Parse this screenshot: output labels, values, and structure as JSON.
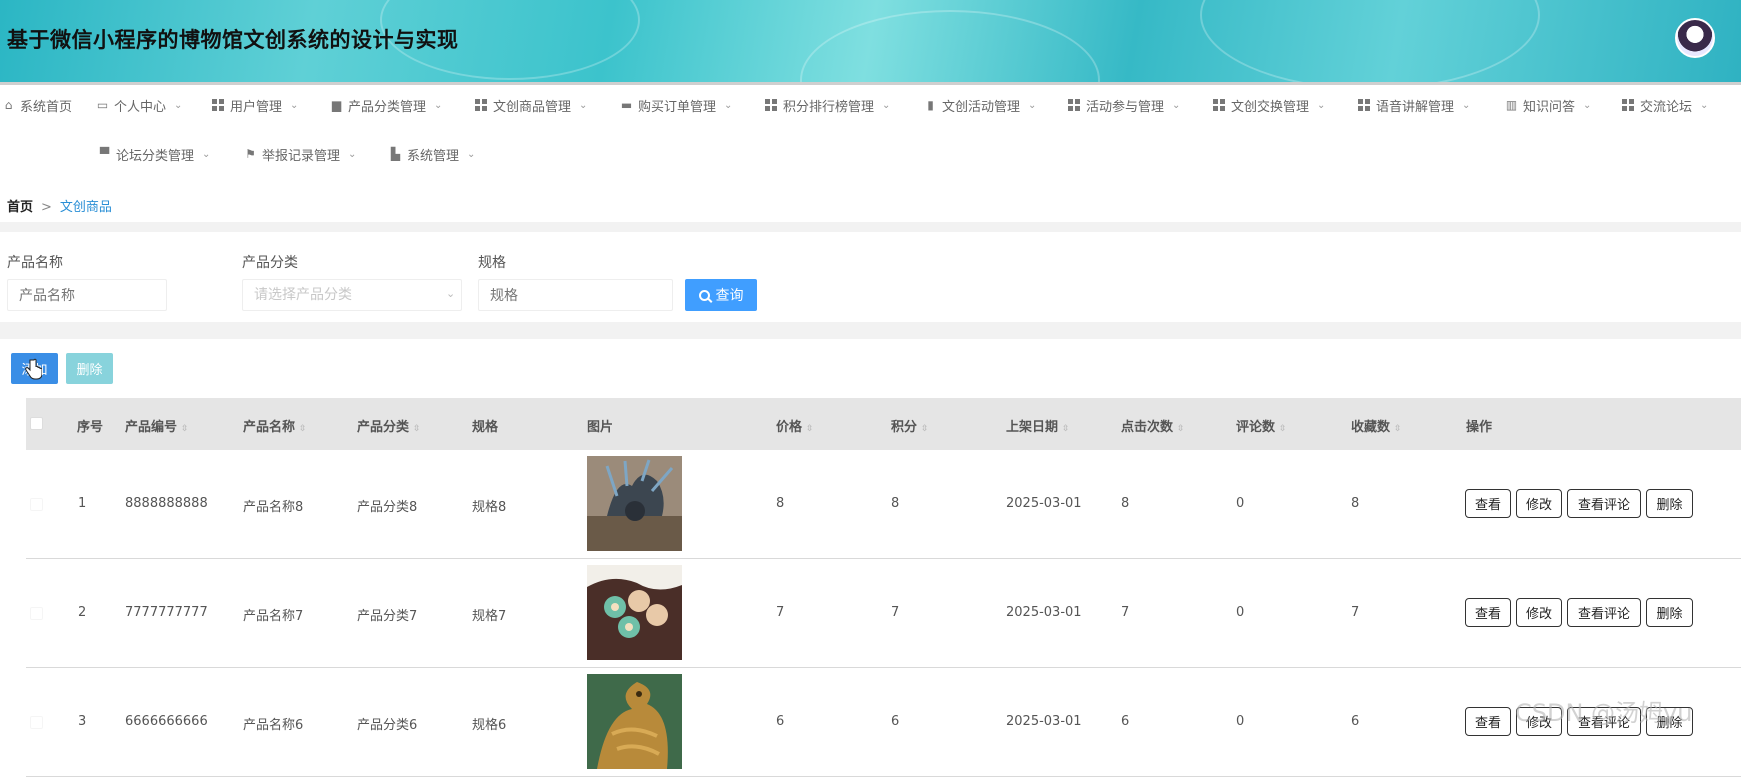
{
  "app": {
    "title": "基于微信小程序的博物馆文创系统的设计与实现"
  },
  "nav": {
    "row1": [
      {
        "label": "系统首页",
        "icon": "home-icon",
        "has_menu": false
      },
      {
        "label": "个人中心",
        "icon": "card-icon",
        "has_menu": true
      },
      {
        "label": "用户管理",
        "icon": "grid-icon",
        "has_menu": true
      },
      {
        "label": "产品分类管理",
        "icon": "chat-icon",
        "has_menu": true
      },
      {
        "label": "文创商品管理",
        "icon": "grid-icon",
        "has_menu": true
      },
      {
        "label": "购买订单管理",
        "icon": "briefcase-icon",
        "has_menu": true
      },
      {
        "label": "积分排行榜管理",
        "icon": "grid-icon",
        "has_menu": true
      },
      {
        "label": "文创活动管理",
        "icon": "clipboard-icon",
        "has_menu": true
      },
      {
        "label": "活动参与管理",
        "icon": "grid-icon",
        "has_menu": true
      },
      {
        "label": "文创交换管理",
        "icon": "apps-icon",
        "has_menu": true
      },
      {
        "label": "语音讲解管理",
        "icon": "grid-icon",
        "has_menu": true
      },
      {
        "label": "知识问答",
        "icon": "chart-icon",
        "has_menu": true
      },
      {
        "label": "交流论坛",
        "icon": "grid-icon",
        "has_menu": true
      }
    ],
    "row2": [
      {
        "label": "论坛分类管理",
        "icon": "monitor-icon",
        "has_menu": true
      },
      {
        "label": "举报记录管理",
        "icon": "flag-icon",
        "has_menu": true
      },
      {
        "label": "系统管理",
        "icon": "settings-icon",
        "has_menu": true
      }
    ]
  },
  "breadcrumb": {
    "home": "首页",
    "separator": ">",
    "current": "文创商品"
  },
  "search": {
    "name_label": "产品名称",
    "name_placeholder": "产品名称",
    "category_label": "产品分类",
    "category_placeholder": "请选择产品分类",
    "spec_label": "规格",
    "spec_placeholder": "规格",
    "query_button": "查询"
  },
  "actions": {
    "add": "添加",
    "delete": "删除"
  },
  "table": {
    "columns": {
      "index": "序号",
      "code": "产品编号",
      "name": "产品名称",
      "category": "产品分类",
      "spec": "规格",
      "image": "图片",
      "price": "价格",
      "points": "积分",
      "date": "上架日期",
      "clicks": "点击次数",
      "comments": "评论数",
      "favorites": "收藏数",
      "ops": "操作"
    },
    "row_buttons": {
      "view": "查看",
      "edit": "修改",
      "view_comments": "查看评论",
      "delete": "删除"
    },
    "rows": [
      {
        "index": "1",
        "code": "8888888888",
        "name": "产品名称8",
        "category": "产品分类8",
        "spec": "规格8",
        "price": "8",
        "points": "8",
        "date": "2025-03-01",
        "clicks": "8",
        "comments": "0",
        "favorites": "8"
      },
      {
        "index": "2",
        "code": "7777777777",
        "name": "产品名称7",
        "category": "产品分类7",
        "spec": "规格7",
        "price": "7",
        "points": "7",
        "date": "2025-03-01",
        "clicks": "7",
        "comments": "0",
        "favorites": "7"
      },
      {
        "index": "3",
        "code": "6666666666",
        "name": "产品名称6",
        "category": "产品分类6",
        "spec": "规格6",
        "price": "6",
        "points": "6",
        "date": "2025-03-01",
        "clicks": "6",
        "comments": "0",
        "favorites": "6"
      }
    ]
  },
  "watermark": "CSDN @汤姆yu",
  "colors": {
    "primary": "#409eff",
    "add_button": "#3a8ee6",
    "delete_button": "#88d3dc",
    "header_teal": "#3cc3cc",
    "breadcrumb_link": "#2a8fd6"
  }
}
